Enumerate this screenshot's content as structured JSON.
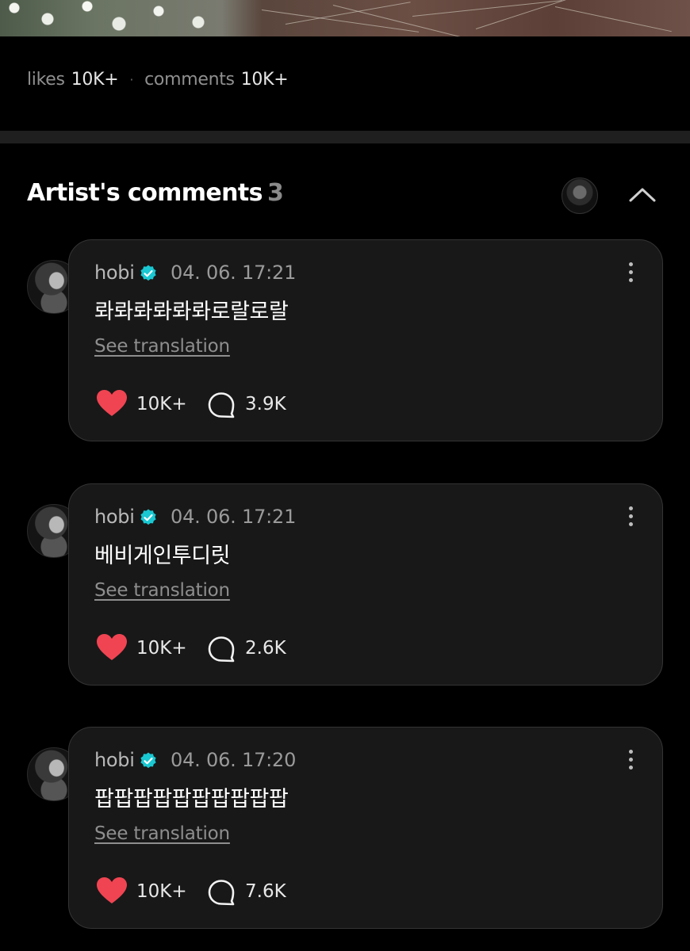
{
  "post_stats": {
    "likes_label": "likes",
    "likes_value": "10K+",
    "separator": "·",
    "comments_label": "comments",
    "comments_value": "10K+"
  },
  "artist_comments": {
    "title": "Artist's comments",
    "count": "3",
    "items": [
      {
        "author": "hobi",
        "timestamp": "04. 06. 17:21",
        "text": "롸롸롸롸롸롸로랄로랄",
        "translation_link": "See translation",
        "likes": "10K+",
        "replies": "3.9K"
      },
      {
        "author": "hobi",
        "timestamp": "04. 06. 17:21",
        "text": "베비게인투디릿",
        "translation_link": "See translation",
        "likes": "10K+",
        "replies": "2.6K"
      },
      {
        "author": "hobi",
        "timestamp": "04. 06. 17:20",
        "text": "팝팝팝팝팝팝팝팝팝팝",
        "translation_link": "See translation",
        "likes": "10K+",
        "replies": "7.6K"
      }
    ]
  },
  "colors": {
    "background": "#000000",
    "card": "#181818",
    "card_border": "#343434",
    "heart": "#f04452",
    "verified": "#19c8d2",
    "muted_text": "#9a9a9a"
  },
  "icons": [
    "verified-badge-icon",
    "more-options-icon",
    "heart-icon",
    "reply-bubble-icon",
    "chevron-up-icon"
  ]
}
